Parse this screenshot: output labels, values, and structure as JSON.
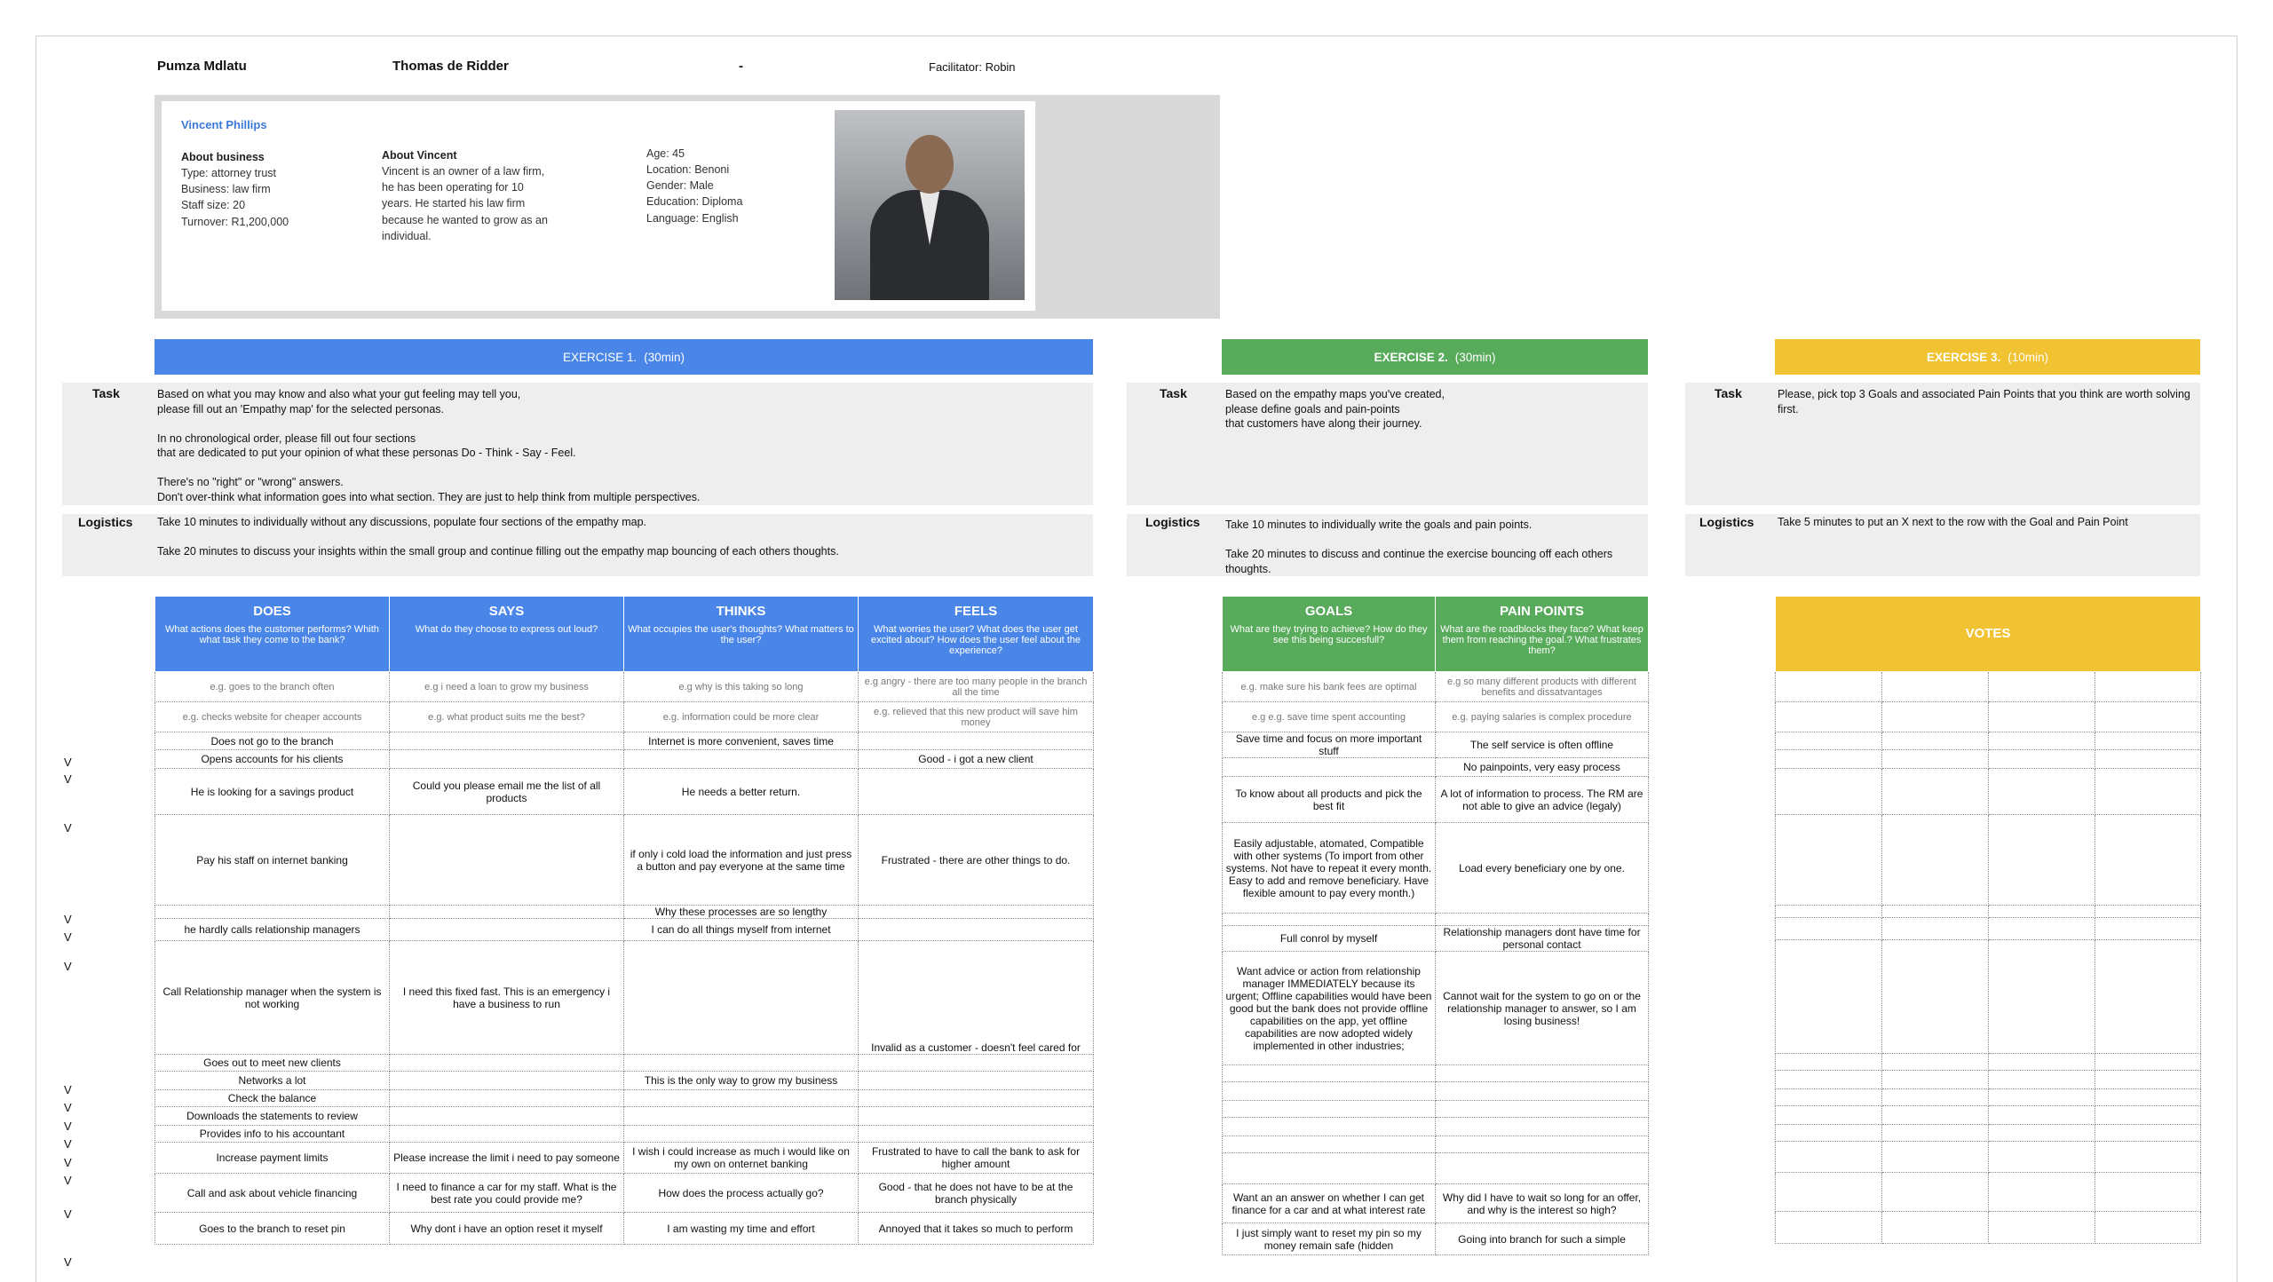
{
  "header": {
    "name1": "Pumza Mdlatu",
    "name2": "Thomas de Ridder",
    "dash": "-",
    "facilitator": "Facilitator: Robin"
  },
  "persona": {
    "name": "Vincent Phillips",
    "business_title": "About business",
    "business_lines": [
      "Type: attorney trust",
      "Business: law firm",
      "Staff size: 20",
      "Turnover: R1,200,000"
    ],
    "about_title": "About Vincent",
    "about_text": "Vincent is an owner of a law firm, he has been operating for 10 years. He started his law firm because he wanted to grow as an individual.",
    "demo_lines": [
      "Age: 45",
      "Location: Benoni",
      "Gender: Male",
      "Education: Diploma",
      "Language: English"
    ]
  },
  "exercises": [
    {
      "title": "EXERCISE 1.",
      "time": "(30min)",
      "color": "#4a86e8"
    },
    {
      "title": "EXERCISE 2.",
      "time": "(30min)",
      "color": "#57ab5a"
    },
    {
      "title": "EXERCISE 3.",
      "time": "(10min)",
      "color": "#f1c232"
    }
  ],
  "labels": {
    "task": "Task",
    "logistics": "Logistics"
  },
  "ex1": {
    "task": [
      "Based on what you may know and also what your gut feeling may tell you,",
      "please fill out an 'Empathy map' for the selected personas.",
      "",
      "In no chronological order, please fill out four sections",
      "that are dedicated to put your opinion of what these personas Do - Think - Say - Feel.",
      "",
      "There's no \"right\" or \"wrong\" answers.",
      "Don't over-think what information goes into what section. They are just to help think from multiple perspectives."
    ],
    "logistics": [
      "Take 10 minutes to individually without any discussions, populate four sections of the empathy map.",
      "",
      "Take 20 minutes to discuss your insights within the small group and continue filling out the empathy map bouncing of each others thoughts."
    ]
  },
  "ex2": {
    "task": [
      "Based on the empathy maps you've created,",
      "please define goals and pain-points",
      "that customers have along their journey."
    ],
    "logistics": [
      "Take 10 minutes to individually write the goals and pain points.",
      "",
      "Take 20 minutes to discuss and continue the exercise bouncing off each others thoughts."
    ]
  },
  "ex3": {
    "task": [
      "Please, pick top 3 Goals and associated Pain Points that you think are worth solving first."
    ],
    "logistics": [
      "Take 5 minutes to put an X next to the row with the Goal and Pain Point"
    ]
  },
  "empathy": {
    "headers": [
      {
        "title": "DOES",
        "sub": "What actions does the customer performs? Whith what task they come to the bank?"
      },
      {
        "title": "SAYS",
        "sub": "What do they choose to express out loud?"
      },
      {
        "title": "THINKS",
        "sub": "What occupies the user's thoughts? What matters to the user?"
      },
      {
        "title": "FEELS",
        "sub": "What worries the user? What does the user get excited about? How does the user feel about the experience?"
      }
    ],
    "examples": [
      [
        "e.g. goes to the branch often",
        "e.g i need a loan to grow my business",
        "e.g why is this taking so long",
        "e.g angry - there are too many people in the branch all the time"
      ],
      [
        "e.g. checks website for cheaper accounts",
        "e.g. what product suits me the best?",
        "e.g. information could be more clear",
        "e.g. relieved that this new product will save him money"
      ]
    ],
    "rows": [
      [
        "Does not go to the branch",
        "",
        "Internet is more convenient, saves time",
        ""
      ],
      [
        "Opens accounts for his clients",
        "",
        "",
        "Good - i got a new client"
      ],
      [
        "He is looking for a savings product",
        "Could you please email me the list of all products",
        "He needs a better return.",
        ""
      ],
      [
        "Pay his staff on internet banking",
        "",
        "if only i cold load the information and just press a button and pay everyone at the same time",
        "Frustrated - there are other things to do."
      ],
      [
        "",
        "",
        "Why these processes are so lengthy",
        ""
      ],
      [
        "he hardly calls relationship managers",
        "",
        "I can do all things myself from internet",
        ""
      ],
      [
        "Call Relationship manager when the system is not working",
        "I need this fixed fast. This is an emergency i have a business to run",
        "",
        "Invalid as a customer - doesn't feel cared for"
      ],
      [
        "Goes out to meet new clients",
        "",
        "",
        ""
      ],
      [
        "Networks a lot",
        "",
        "This is the only way to grow my business",
        ""
      ],
      [
        "Check the balance",
        "",
        "",
        ""
      ],
      [
        "Downloads the statements to review",
        "",
        "",
        ""
      ],
      [
        "Provides info to his accountant",
        "",
        "",
        ""
      ],
      [
        "Increase  payment limits",
        "Please increase the limit i need to pay someone",
        "I wish i could increase as much i would like on my own on onternet banking",
        "Frustrated to have to call the bank to ask for higher amount"
      ],
      [
        "Call and ask about vehicle financing",
        "I need to finance a car for my staff. What is the best rate you could provide me?",
        "How does the process actually go?",
        "Good - that he does not have to be at the branch physically"
      ],
      [
        "Goes to the branch to reset pin",
        "Why dont i have an option reset it myself",
        "I am wasting my time and effort",
        "Annoyed that it takes so much to perform"
      ]
    ]
  },
  "goals": {
    "headers": [
      {
        "title": "GOALS",
        "sub": "What are they trying to achieve? How do they see this being succesfull?"
      },
      {
        "title": "PAIN POINTS",
        "sub": "What are the roadblocks they face? What keep them from reaching the goal.? What frustrates them?"
      }
    ],
    "examples": [
      [
        "e.g. make sure his bank fees are optimal",
        "e.g so many different products with different benefits and dissatvantages"
      ],
      [
        "e.g e.g. save time spent accounting",
        "e.g. paying salaries is complex procedure"
      ]
    ],
    "rows": [
      [
        "Save time and focus on more important stuff",
        "The self service is often offline"
      ],
      [
        "",
        "No painpoints, very easy process"
      ],
      [
        "To know about all products and pick the best fit",
        "A lot of information to process. The RM are not able to give an advice (legaly)"
      ],
      [
        "Easily adjustable, atomated, Compatible with other systems (To import from other systems. Not have to repeat it every month. Easy to add and remove beneficiary. Have flexible amount to pay every month.)",
        "Load every beneficiary one by one."
      ],
      [
        "",
        ""
      ],
      [
        "Full conrol by myself",
        "Relationship managers dont have time for personal contact"
      ],
      [
        "Want advice or action from relationship manager IMMEDIATELY because its urgent; Offline capabilities would have been good but the bank does not provide offline capabilities on the app, yet offline capabilities are now adopted widely implemented in other industries;",
        "Cannot wait for the system to go on or the relationship manager to answer, so I am losing business!"
      ],
      [
        "",
        ""
      ],
      [
        "",
        ""
      ],
      [
        "",
        ""
      ],
      [
        "",
        ""
      ],
      [
        "",
        ""
      ],
      [
        "",
        ""
      ],
      [
        "Want an an answer on whether I can get finance for a car and at what interest rate",
        "Why did I have to wait so long for an offer, and why is the interest so high?"
      ],
      [
        "I just simply want to reset my pin so my money remain safe (hidden",
        "Going into branch for such a simple"
      ]
    ]
  },
  "votes": {
    "title": "VOTES"
  },
  "v_marks": [
    "V",
    "V",
    "V",
    "V",
    "V",
    "V",
    "V",
    "V",
    "V",
    "V",
    "V",
    "V",
    "V",
    "V"
  ]
}
